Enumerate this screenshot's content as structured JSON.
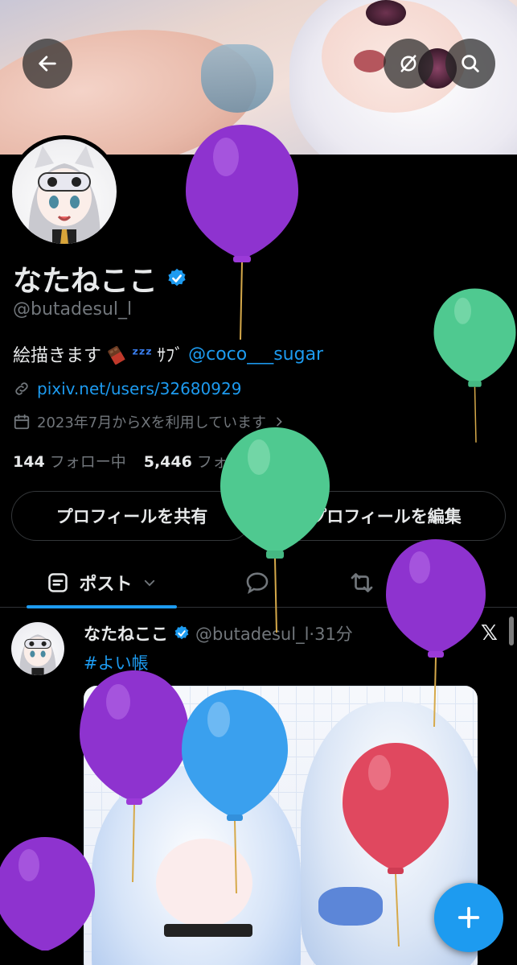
{
  "profile": {
    "display_name": "なたねここ",
    "handle": "@butadesul_l",
    "bio_text": "絵描きます",
    "bio_zzz": "ᶻᶻᶻ",
    "bio_sub": "ｻﾌﾞ",
    "bio_mention": "@coco___sugar",
    "link": "pixiv.net/users/32680929",
    "joined": "2023年7月からXを利用しています",
    "following_count": "144",
    "following_label": "フォロー中",
    "followers_count": "5,446",
    "followers_label": "フォロワー"
  },
  "buttons": {
    "share_profile": "プロフィールを共有",
    "edit_profile": "プロフィールを編集"
  },
  "tabs": {
    "posts_label": "ポスト"
  },
  "post": {
    "author": "なたねここ",
    "handle_time": "@butadesul_l·31分",
    "hashtag": "#よい帳",
    "source_glyph": "𝕏"
  },
  "colors": {
    "accent": "#1d9bf0",
    "verified": "#1d9bf0",
    "balloon_purple": "#8a2fc7",
    "balloon_green": "#4cc98f",
    "balloon_blue": "#3aa0ee",
    "balloon_red": "#e0485f"
  },
  "icons": {
    "back": "arrow-left-icon",
    "hide": "eye-slash-icon",
    "search": "search-icon",
    "link": "link-icon",
    "calendar": "calendar-icon",
    "chevron": "chevron-right-icon",
    "compose": "plus-icon"
  }
}
